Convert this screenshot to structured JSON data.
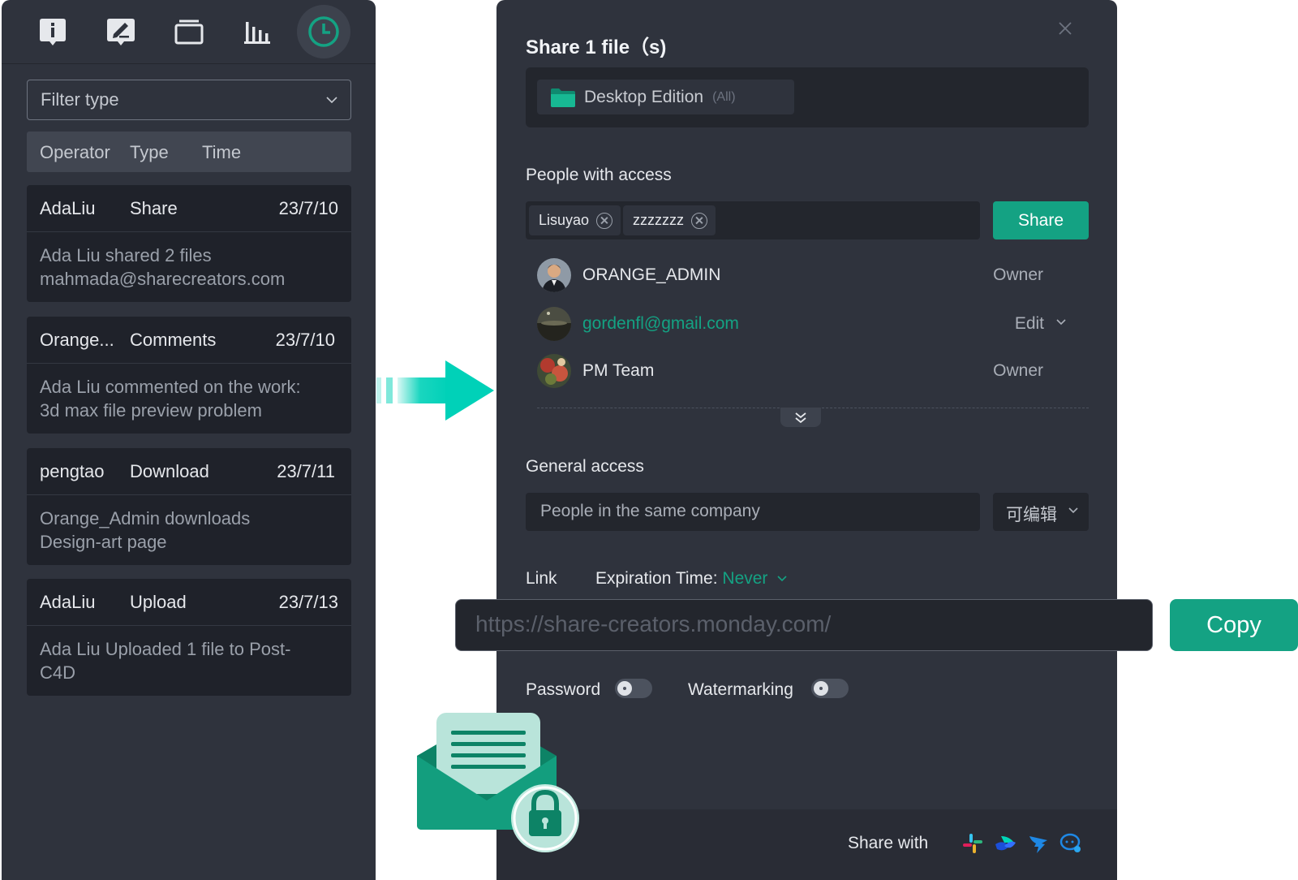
{
  "toolbar": {
    "icons": [
      "info-icon",
      "comment-edit-icon",
      "versions-icon",
      "stats-icon",
      "history-clock-icon"
    ],
    "active": "history-clock-icon"
  },
  "filter": {
    "placeholder": "Filter type"
  },
  "activity_table": {
    "columns": [
      "Operator",
      "Type",
      "Time"
    ],
    "rows": [
      {
        "operator": "AdaLiu",
        "type": "Share",
        "time": "23/7/10",
        "detail_1": "Ada Liu shared 2 files",
        "detail_2": "mahmada@sharecreators.com"
      },
      {
        "operator": "Orange...",
        "type": "Comments",
        "time": "23/7/10",
        "detail_1": "Ada Liu commented on the work:",
        "detail_2": "3d max file preview problem"
      },
      {
        "operator": "pengtao",
        "type": "Download",
        "time": "23/7/11",
        "detail_1": "Orange_Admin downloads",
        "detail_2": "Design-art page"
      },
      {
        "operator": "AdaLiu",
        "type": "Upload",
        "time": "23/7/13",
        "detail_1": "Ada Liu Uploaded 1 file to Post-",
        "detail_2": "C4D"
      }
    ]
  },
  "dialog": {
    "title": "Share 1 file（s)",
    "file_name": "Desktop Edition",
    "file_scope": "(All)",
    "people_label": "People with access",
    "tags": [
      "Lisuyao",
      "zzzzzzz"
    ],
    "share_button": "Share",
    "people": [
      {
        "name": "ORANGE_ADMIN",
        "role": "Owner"
      },
      {
        "name": "gordenfl@gmail.com",
        "role": "Edit"
      },
      {
        "name": "PM Team",
        "role": "Owner"
      }
    ],
    "general_access_label": "General access",
    "general_access_value": "People in the same company",
    "permission_value": "可编辑",
    "link_label": "Link",
    "expiration_label": "Expiration Time: ",
    "expiration_value": "Never",
    "password_label": "Password",
    "watermark_label": "Watermarking",
    "share_with_label": "Share with",
    "share_with_icons": [
      "slack-icon",
      "lark-icon",
      "dingtalk-icon",
      "wechat-work-icon"
    ]
  },
  "link_bar": {
    "url": "https://share-creators.monday.com/",
    "copy_button": "Copy"
  },
  "colors": {
    "accent": "#14a283",
    "panel": "#2f333d",
    "card": "#1f222a",
    "arrow": "#00d1b8"
  }
}
